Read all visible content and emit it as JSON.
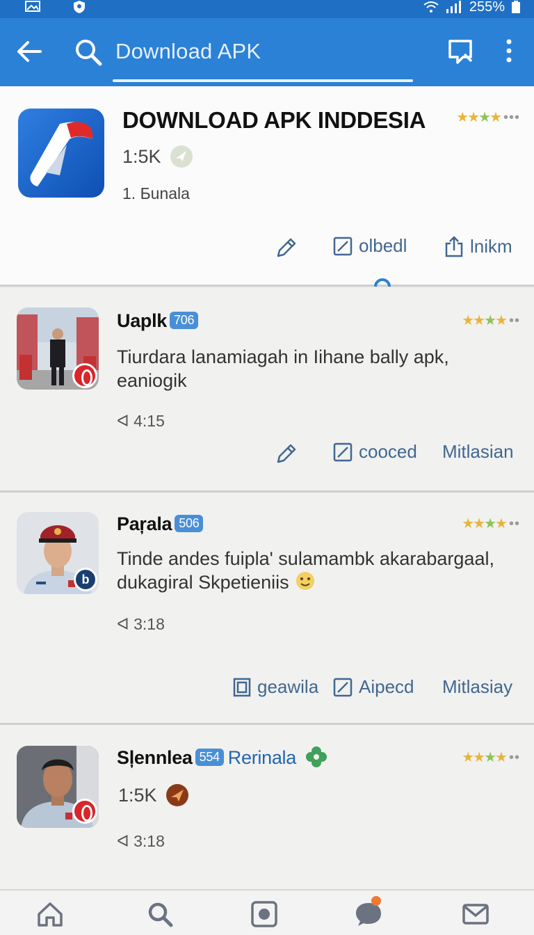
{
  "status_bar": {
    "battery": "255%",
    "icons": [
      "image-icon",
      "shield-icon",
      "wifi-icon",
      "signal-icon",
      "battery-icon"
    ]
  },
  "app_bar": {
    "search_query": "Download APK",
    "icons": [
      "back-arrow-icon",
      "search-icon",
      "message-icon",
      "more-vert-icon"
    ]
  },
  "colors": {
    "app_bar": "#2b81d6",
    "status_bar": "#1f6fc4",
    "accent_badge": "#4a8fd6",
    "star_gold": "#e8b53a",
    "star_green": "#8fc25a",
    "action_text": "#41678f"
  },
  "featured": {
    "title": "DOWNLOAD APK INDDESIA",
    "count": "1:5K",
    "subtitle": "1. Бunala",
    "rating_stars": 3,
    "actions": [
      {
        "icon": "pencil-icon",
        "label": ""
      },
      {
        "icon": "edit-box-icon",
        "label": "olbedl"
      },
      {
        "icon": "share-icon",
        "label": "lnikm"
      }
    ]
  },
  "posts": [
    {
      "name": "Uaplk",
      "badge": "706",
      "text": "Tiurdara lanamiagah in Iihane bally apk, eaniogik",
      "time": "4:15",
      "rating_stars": 3,
      "actions": [
        {
          "icon": "pencil-icon",
          "label": ""
        },
        {
          "icon": "edit-box-icon",
          "label": "cooced"
        },
        {
          "icon": "",
          "label": "Mitlasian"
        }
      ]
    },
    {
      "name": "Paŗala",
      "badge": "506",
      "text": "Tinde andes fuipla' sulamambk akarabargaal, dukagiral Skpetieniis",
      "time": "3:18",
      "rating_stars": 3,
      "actions": [
        {
          "icon": "gallery-icon",
          "label": "geawila"
        },
        {
          "icon": "edit-box-icon",
          "label": "Aipecd"
        },
        {
          "icon": "",
          "label": "Mitlasiay"
        }
      ]
    },
    {
      "name": "Sļennlea",
      "badge": "554",
      "extra": "Rerinala",
      "count": "1:5K",
      "time": "3:18",
      "rating_stars": 3
    }
  ],
  "bottom_nav": [
    "home-icon",
    "search-icon",
    "record-icon",
    "chat-icon",
    "mail-icon"
  ]
}
